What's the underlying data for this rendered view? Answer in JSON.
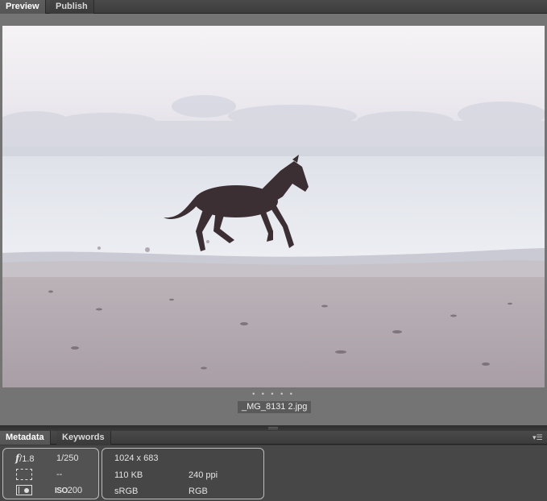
{
  "top_tabs": [
    {
      "label": "Preview",
      "active": true
    },
    {
      "label": "Publish",
      "active": false
    }
  ],
  "preview": {
    "filename": "_MG_8131 2.jpg",
    "dots": "• • • • •"
  },
  "bottom_tabs": [
    {
      "label": "Metadata",
      "active": true
    },
    {
      "label": "Keywords",
      "active": false
    }
  ],
  "camera": {
    "aperture_symbol": "f",
    "aperture_value": "/1.8",
    "shutter": "1/250",
    "metering": "--",
    "iso_label": "ISO",
    "iso_value": "200"
  },
  "file_info": {
    "dimensions": "1024 x 683",
    "size": "110 KB",
    "resolution": "240 ppi",
    "color_profile": "sRGB",
    "color_mode": "RGB"
  },
  "colors": {
    "panel_bg": "#474747",
    "preview_bg": "#747474",
    "box_border": "#bdbdbd"
  }
}
